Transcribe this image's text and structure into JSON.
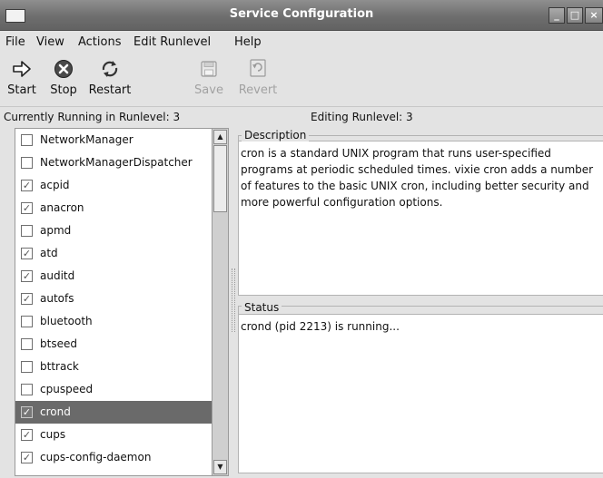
{
  "window": {
    "title": "Service Configuration",
    "controls": [
      "minimize-icon",
      "maximize-icon",
      "close-icon"
    ]
  },
  "menubar": {
    "items": [
      {
        "label": "File"
      },
      {
        "label": "View"
      },
      {
        "label": "Actions"
      },
      {
        "label": "Edit Runlevel"
      },
      {
        "label": "Help"
      }
    ]
  },
  "toolbar": {
    "start": {
      "label": "Start",
      "icon": "arrow-right-icon"
    },
    "stop": {
      "label": "Stop",
      "icon": "stop-circle-icon"
    },
    "restart": {
      "label": "Restart",
      "icon": "restart-icon"
    },
    "save": {
      "label": "Save",
      "icon": "save-icon",
      "disabled": true
    },
    "revert": {
      "label": "Revert",
      "icon": "revert-icon",
      "disabled": true
    }
  },
  "runlevel": {
    "current": "Currently Running in Runlevel: 3",
    "editing": "Editing Runlevel: 3"
  },
  "services": [
    {
      "name": "NetworkManager",
      "checked": false
    },
    {
      "name": "NetworkManagerDispatcher",
      "checked": false
    },
    {
      "name": "acpid",
      "checked": true
    },
    {
      "name": "anacron",
      "checked": true
    },
    {
      "name": "apmd",
      "checked": false
    },
    {
      "name": "atd",
      "checked": true
    },
    {
      "name": "auditd",
      "checked": true
    },
    {
      "name": "autofs",
      "checked": true
    },
    {
      "name": "bluetooth",
      "checked": false
    },
    {
      "name": "btseed",
      "checked": false
    },
    {
      "name": "bttrack",
      "checked": false
    },
    {
      "name": "cpuspeed",
      "checked": false
    },
    {
      "name": "crond",
      "checked": true,
      "selected": true
    },
    {
      "name": "cups",
      "checked": true
    },
    {
      "name": "cups-config-daemon",
      "checked": true
    }
  ],
  "description": {
    "label": "Description",
    "text": "cron is a standard UNIX program that runs user-specified programs at periodic scheduled times. vixie cron adds a number of features to the basic UNIX cron, including better security and more powerful configuration options."
  },
  "status": {
    "label": "Status",
    "text": "crond (pid 2213) is running..."
  },
  "colors": {
    "titlebar": "#6e6e6e",
    "selection": "#6a6a6a",
    "disabled_text": "#a2a2a2"
  }
}
